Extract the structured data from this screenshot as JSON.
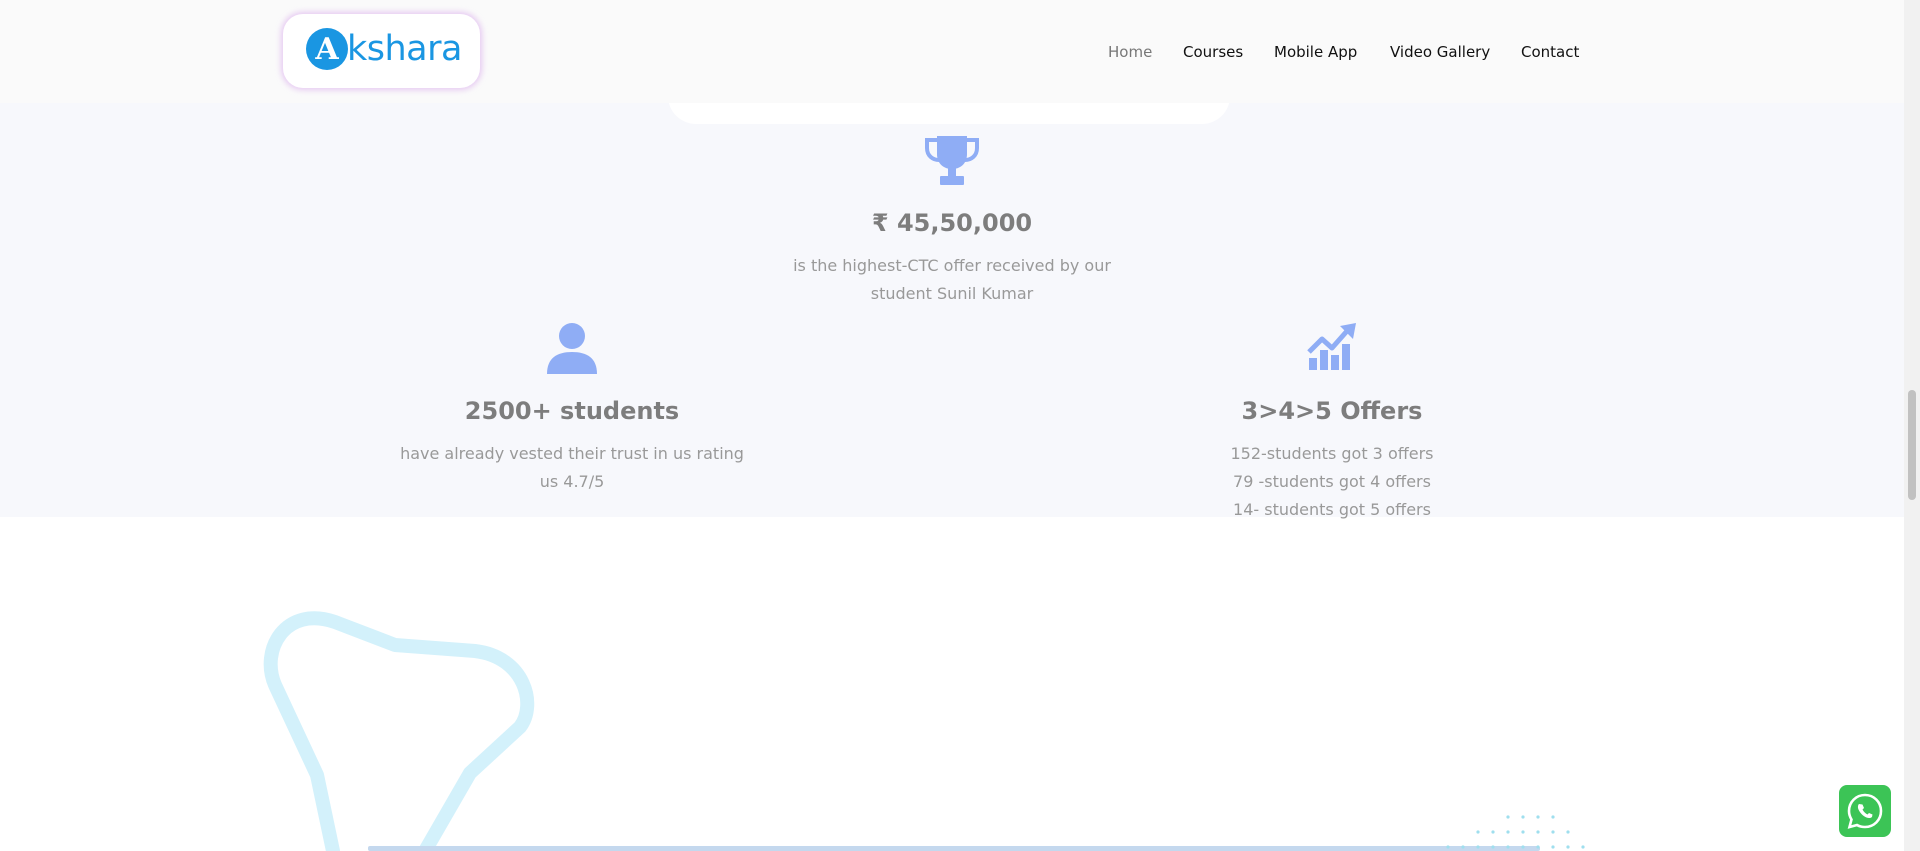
{
  "navbar": {
    "logo": {
      "text": "kshara",
      "glyph": "A",
      "color": "#1a96e2"
    },
    "menu": [
      {
        "label": "Home",
        "active": true
      },
      {
        "label": "Courses",
        "active": false
      },
      {
        "label": "Mobile App",
        "active": false
      },
      {
        "label": "Video Gallery",
        "active": false
      },
      {
        "label": "Contact",
        "active": false
      }
    ]
  },
  "stats": {
    "ctc": {
      "icon": "trophy-icon",
      "title": "₹ 45,50,000",
      "desc_line1": "is the highest-CTC offer received by our",
      "desc_line2": "student Sunil Kumar"
    },
    "students": {
      "icon": "user-icon",
      "title": "2500+ students",
      "desc_line1": "have already vested their trust in us rating",
      "desc_line2": "us 4.7/5"
    },
    "offers": {
      "icon": "chart-growth-icon",
      "title": "3>4>5 Offers",
      "desc_lines": [
        "152-students got 3 offers",
        "79 -students got 4 offers",
        "14- students got 5 offers"
      ]
    }
  },
  "colors": {
    "icon": "#8fadf5",
    "band": "#f7f8fc",
    "deco": "#d3f1fb",
    "whatsapp": "#3cc456"
  },
  "floating": {
    "whatsapp_icon": "whatsapp-icon"
  }
}
